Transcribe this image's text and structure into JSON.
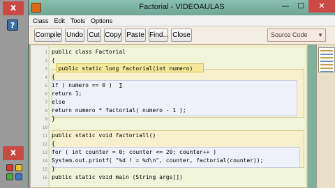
{
  "window": {
    "title": "Factorial - VIDEOAULAS",
    "minimize": "—",
    "maximize": "☐",
    "close": "✕"
  },
  "menu": [
    "Class",
    "Edit",
    "Tools",
    "Options"
  ],
  "toolbar": {
    "compile": "Compile",
    "undo": "Undo",
    "cut": "Cut",
    "copy": "Copy",
    "paste": "Paste",
    "find": "Find...",
    "close": "Close",
    "view_select": "Source Code"
  },
  "side_strip": {
    "close": "x",
    "help": "?"
  },
  "code_lines": [
    "public class Factorial",
    "{",
    "  public static long factorial(int numero)",
    "{",
    "if ( numero == 0 )",
    "return 1;",
    "else",
    "return numero * factorial( numero - 1 );",
    "}",
    "",
    "public static void factoriall()",
    "{",
    "for ( int counter = 0; counter <= 20; counter++ )",
    "System.out.printf( \"%d ! = %d\\n\", counter, factorial(counter));",
    "}",
    "public static void main (String args[])"
  ],
  "colors": {
    "window_frame": "#7fb0a0",
    "editor_bg": "#fbf6d7",
    "method_highlight": "#f5e89a",
    "close_red": "#c94a45"
  }
}
